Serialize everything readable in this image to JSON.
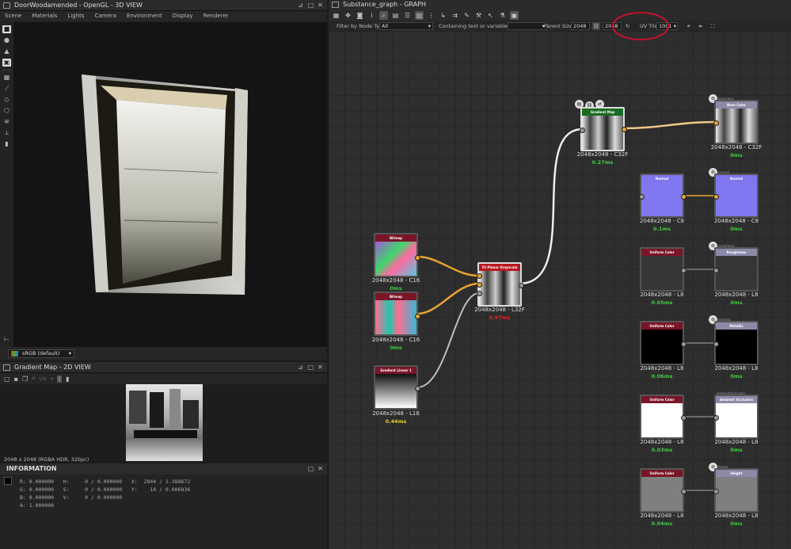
{
  "view3d": {
    "title": "DoorWoodamended - OpenGL - 3D VIEW",
    "menu": [
      "Scene",
      "Materials",
      "Lights",
      "Camera",
      "Environment",
      "Display",
      "Renderer"
    ],
    "colorspace": "sRGB (default)"
  },
  "view2d": {
    "title": "Gradient Map - 2D VIEW",
    "uv_label": "UV",
    "status": "2048 x 2048 (RGBA HDR, 32bpc)"
  },
  "info": {
    "title": "INFORMATION",
    "lines": [
      "R: 0.000000   H:     0 / 0.000000   X:  2844 / 1.388672",
      "G: 0.000000   S:     0 / 0.000000   Y:    14 / 0.006836",
      "B: 0.000000   V:     0 / 0.000000",
      "A: 1.000000"
    ]
  },
  "graph": {
    "title": "Substance_graph - GRAPH",
    "filter_label": "Filter by Node Type",
    "filter_value": "All",
    "containing_label": "Containing text or variable",
    "parent_size_label": "Parent Size:",
    "parent_size_a": "2048",
    "parent_size_b": "2048",
    "uv_tile_label": "UV Tile:",
    "uv_tile_value": "1001",
    "highlight_color": "#c8102e"
  },
  "nodes": {
    "bitmap1": {
      "head": "Bitmap",
      "size": "2048x2048 - C16",
      "time": "0ms"
    },
    "bitmap2": {
      "head": "Bitmap",
      "size": "2048x2048 - C16",
      "time": "0ms"
    },
    "gradlin": {
      "head": "Gradient Linear 1",
      "size": "2048x2048 - L16",
      "time": "0.44ms"
    },
    "triplanar": {
      "head": "Tri Planar Grayscale",
      "size": "2048x2048 - L32F",
      "time": "0.97ms"
    },
    "gradmap": {
      "head": "Gradient Map",
      "size": "2048x2048 - C32F",
      "time": "0.27ms"
    },
    "basecolor": {
      "outname": "basecolor",
      "head": "Base Color",
      "size": "2048x2048 - C32F",
      "time": "0ms"
    },
    "normal_src": {
      "head": "Normal",
      "size": "2048x2048 - C8",
      "time": "0.1ms"
    },
    "normal_out": {
      "outname": "normal",
      "head": "Normal",
      "size": "2048x2048 - C8",
      "time": "0ms"
    },
    "uc_rough": {
      "head": "Uniform Color",
      "size": "2048x2048 - L8",
      "time": "0.05ms"
    },
    "roughness": {
      "outname": "roughness",
      "head": "Roughness",
      "size": "2048x2048 - L8",
      "time": "0ms"
    },
    "uc_metal": {
      "head": "Uniform Color",
      "size": "2048x2048 - L8",
      "time": "0.06ms"
    },
    "metallic": {
      "outname": "metallic",
      "head": "Metallic",
      "size": "2048x2048 - L8",
      "time": "0ms"
    },
    "uc_ao": {
      "head": "Uniform Color",
      "size": "2048x2048 - L8",
      "time": "0.03ms"
    },
    "ao": {
      "outname": "ambientOcclusion",
      "head": "Ambient Occlusion",
      "size": "2048x2048 - L8",
      "time": "0ms"
    },
    "uc_height": {
      "head": "Uniform Color",
      "size": "2048x2048 - L8",
      "time": "0.04ms"
    },
    "height": {
      "outname": "height",
      "head": "Height",
      "size": "2048x2048 - L8",
      "time": "0ms"
    }
  }
}
